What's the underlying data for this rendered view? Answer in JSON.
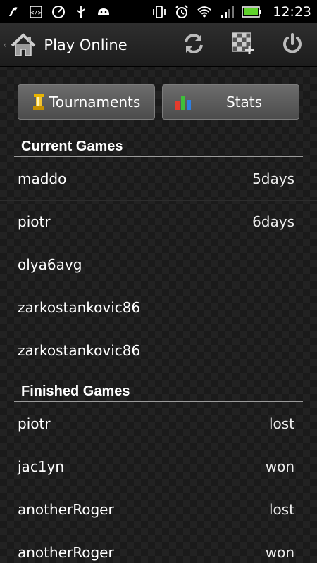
{
  "status_bar": {
    "time": "12:23",
    "left_icons": [
      "notification-icon",
      "code-icon",
      "speedometer-icon",
      "usb-icon",
      "android-icon"
    ],
    "right_icons": [
      "vibrate-icon",
      "alarm-icon",
      "wifi-icon",
      "signal-icon",
      "battery-icon"
    ],
    "battery_color": "#5fd12b"
  },
  "action_bar": {
    "title": "Play Online",
    "actions": [
      "refresh-icon",
      "new-game-icon",
      "power-icon"
    ]
  },
  "buttons": {
    "tournaments": "Tournaments",
    "stats": "Stats"
  },
  "current_games": {
    "header": "Current Games",
    "rows": [
      {
        "name": "maddo",
        "status": "5days"
      },
      {
        "name": "piotr",
        "status": "6days"
      },
      {
        "name": "olya6avg",
        "status": ""
      },
      {
        "name": "zarkostankovic86",
        "status": ""
      },
      {
        "name": "zarkostankovic86",
        "status": ""
      }
    ]
  },
  "finished_games": {
    "header": "Finished Games",
    "rows": [
      {
        "name": "piotr",
        "status": "lost"
      },
      {
        "name": "jac1yn",
        "status": "won"
      },
      {
        "name": "anotherRoger",
        "status": "lost"
      },
      {
        "name": "anotherRoger",
        "status": "won"
      }
    ]
  }
}
